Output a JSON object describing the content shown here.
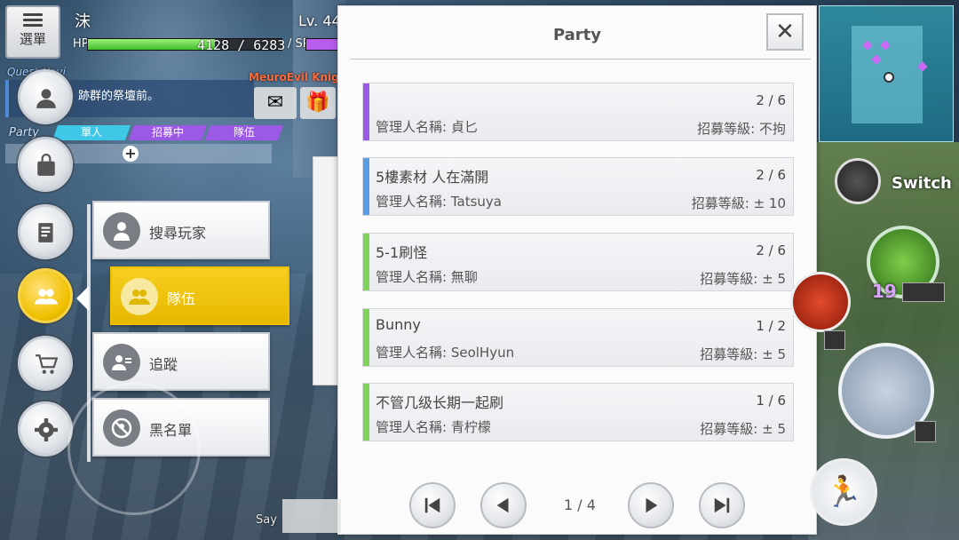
{
  "hud": {
    "menu_label": "選單",
    "player_name": "沫",
    "level": "Lv. 44",
    "hp_label": "HP",
    "hp_text": "4128 / 6283",
    "hp_fraction": 0.657,
    "sp_label": "/ SP",
    "quest_nav_label": "Quest Navi",
    "quest_text": "跡群的祭壇前。",
    "other_player_name": "MeuroEvil Knight",
    "party_label": "Party",
    "party_tabs": [
      "單人",
      "招募中",
      "隊伍"
    ],
    "say_label": "Say",
    "switch_label": "Switch",
    "skill_count": "19"
  },
  "side_menu": {
    "icons": [
      {
        "name": "profile-icon"
      },
      {
        "name": "bag-icon"
      },
      {
        "name": "quest-log-icon"
      },
      {
        "name": "party-icon",
        "active": true
      },
      {
        "name": "shop-cart-icon"
      },
      {
        "name": "settings-gear-icon"
      }
    ],
    "sub_items": [
      {
        "label": "搜尋玩家",
        "icon": "search-player-icon"
      },
      {
        "label": "隊伍",
        "icon": "party-group-icon",
        "active": true
      },
      {
        "label": "追蹤",
        "icon": "follow-icon"
      },
      {
        "label": "黑名單",
        "icon": "blacklist-icon"
      }
    ]
  },
  "panel": {
    "title": "Party",
    "close_label": "✕",
    "page_text": "1 / 4",
    "rows": [
      {
        "name": "",
        "count": "2 / 6",
        "manager": "管理人名稱: 貞匕",
        "requirement": "招募等級: 不拘",
        "accent": "#9b59e6"
      },
      {
        "name": "5樓素材 人在滿開",
        "count": "2 / 6",
        "manager": "管理人名稱: Tatsuya",
        "requirement": "招募等級: ± 10",
        "accent": "#5a9be6"
      },
      {
        "name": "5-1刷怪",
        "count": "2 / 6",
        "manager": "管理人名稱: 無聊",
        "requirement": "招募等級: ± 5",
        "accent": "#7fd35a"
      },
      {
        "name": "Bunny",
        "count": "1 / 2",
        "manager": "管理人名稱: SeolHyun",
        "requirement": "招募等級: ± 5",
        "accent": "#7fd35a"
      },
      {
        "name": "不管几级长期一起刷",
        "count": "1 / 6",
        "manager": "管理人名稱: 青柠檬",
        "requirement": "招募等級: ± 5",
        "accent": "#7fd35a"
      }
    ]
  }
}
